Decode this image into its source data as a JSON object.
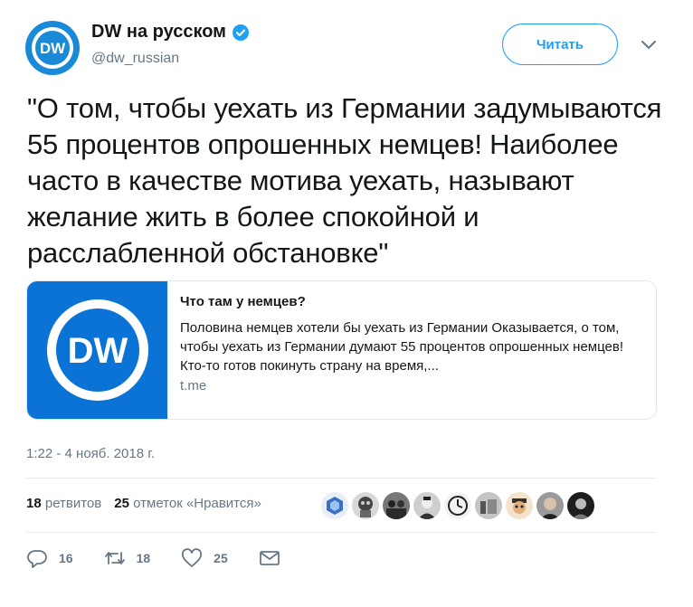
{
  "account": {
    "display_name": "DW на русском",
    "handle": "@dw_russian",
    "avatar_logo": "DW",
    "brand_color": "#1a8ad8"
  },
  "follow_button": {
    "label": "Читать"
  },
  "tweet": {
    "text": "\"О том, чтобы уехать из Германии задумываются 55 процентов опрошенных немцев! Наиболее часто в качестве мотива уехать, называют желание жить в более спокойной и расслабленной обстановке\""
  },
  "card": {
    "logo": "DW",
    "title": "Что там у немцев?",
    "description": "Половина немцев хотели бы уехать из Германии Оказывается, о том, чтобы уехать из Германии думают 55 процентов опрошенных немцев! Кто-то готов покинуть страну на время,...",
    "domain": "t.me"
  },
  "timestamp": "1:22 - 4 нояб. 2018 г.",
  "stats": {
    "retweets_count": "18",
    "retweets_label": "ретвитов",
    "likes_count": "25",
    "likes_label": "отметок «Нравится»"
  },
  "likers": [
    {
      "icon": "blue-hexagon-avatar",
      "color": "#3a6fc4"
    },
    {
      "icon": "gasmask-avatar",
      "color": "#555555"
    },
    {
      "icon": "group-avatar",
      "color": "#444444"
    },
    {
      "icon": "portrait-avatar",
      "color": "#3a3a3a"
    },
    {
      "icon": "clock-avatar",
      "color": "#bbbbbb"
    },
    {
      "icon": "figures-avatar",
      "color": "#8a8a8a"
    },
    {
      "icon": "cartoon-avatar",
      "color": "#d9a06a"
    },
    {
      "icon": "face-avatar",
      "color": "#2a2a2a"
    },
    {
      "icon": "dark-avatar",
      "color": "#333333"
    }
  ],
  "actions": {
    "reply_count": "16",
    "retweet_count": "18",
    "like_count": "25",
    "icons": [
      "reply-icon",
      "retweet-icon",
      "like-icon",
      "direct-message-icon"
    ]
  },
  "colors": {
    "accent": "#1da1f2",
    "secondary_text": "#657786",
    "border": "#e1e8ed"
  }
}
